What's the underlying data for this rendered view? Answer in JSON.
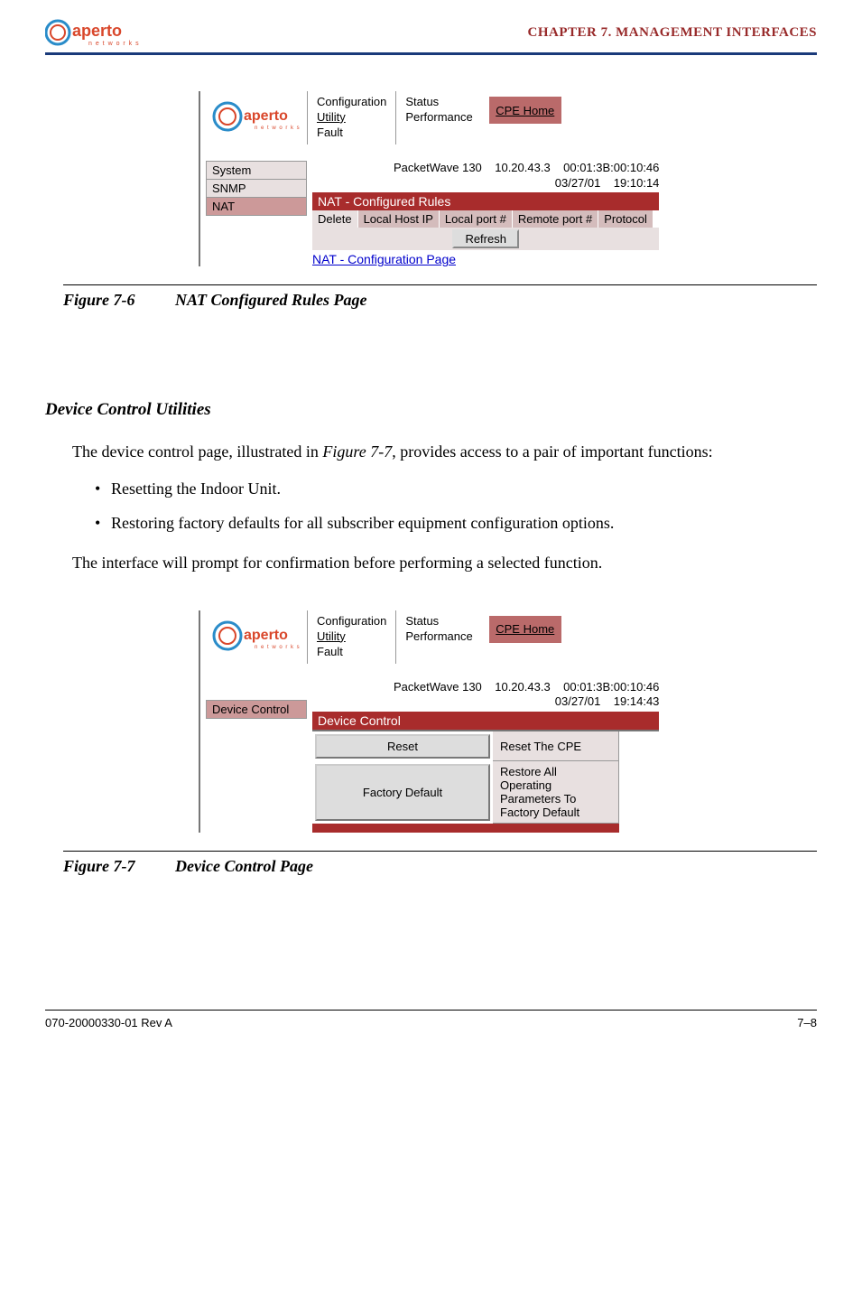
{
  "header": {
    "chapter": "CHAPTER 7.  MANAGEMENT INTERFACES"
  },
  "figure76": {
    "nav": {
      "col1": [
        "Configuration",
        "Utility",
        "Fault"
      ],
      "col2": [
        "Status",
        "Performance"
      ],
      "cpe_home": "CPE Home"
    },
    "meta_line1": "PacketWave 130    10.20.43.3    00:01:3B:00:10:46",
    "meta_line2": "03/27/01    19:10:14",
    "sidebar": [
      "System",
      "SNMP",
      "NAT"
    ],
    "bar_title": "NAT - Configured Rules",
    "table_headers": [
      "Delete",
      "Local Host IP",
      "Local port #",
      "Remote port #",
      "Protocol"
    ],
    "refresh_label": "Refresh",
    "config_link": "NAT - Configuration Page",
    "caption_num": "Figure 7-6",
    "caption_text": "NAT Configured Rules Page"
  },
  "body": {
    "section_heading": "Device Control Utilities",
    "para1_a": "The device control page, illustrated in ",
    "para1_ref": "Figure 7-7",
    "para1_b": ", provides access to a pair of important functions:",
    "bullet1": "Resetting the Indoor Unit.",
    "bullet2_a": "Restoring factory defaults for ",
    "bullet2_i": "all",
    "bullet2_b": " subscriber equipment configuration options.",
    "para2": "The interface will prompt for confirmation before performing a selected function."
  },
  "figure77": {
    "nav": {
      "col1": [
        "Configuration",
        "Utility",
        "Fault"
      ],
      "col2": [
        "Status",
        "Performance"
      ],
      "cpe_home": "CPE Home"
    },
    "meta_line1": "PacketWave 130    10.20.43.3    00:01:3B:00:10:46",
    "meta_line2": "03/27/01    19:14:43",
    "sidebar": [
      "Device Control"
    ],
    "bar_title": "Device Control",
    "buttons": [
      {
        "label": "Reset",
        "desc": "Reset The CPE"
      },
      {
        "label": "Factory Default",
        "desc": "Restore All Operating Parameters To Factory Default"
      }
    ],
    "caption_num": "Figure 7-7",
    "caption_text": "Device Control Page"
  },
  "footer": {
    "left": "070-20000330-01 Rev A",
    "right": "7–8"
  }
}
